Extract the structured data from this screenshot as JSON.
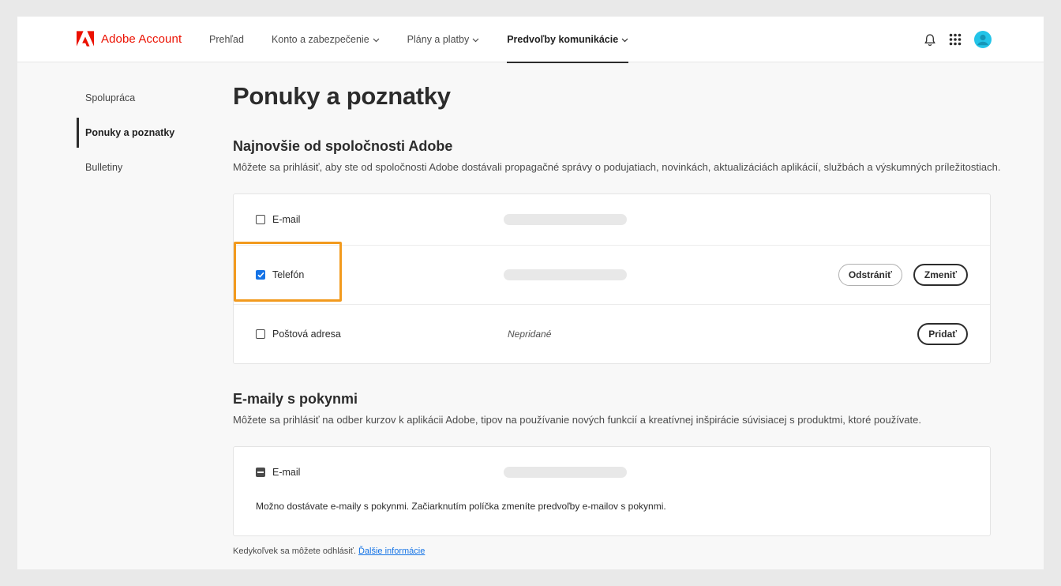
{
  "header": {
    "brand": "Adobe Account",
    "nav": [
      {
        "label": "Prehľad",
        "has_dropdown": false,
        "active": false
      },
      {
        "label": "Konto a zabezpečenie",
        "has_dropdown": true,
        "active": false
      },
      {
        "label": "Plány a platby",
        "has_dropdown": true,
        "active": false
      },
      {
        "label": "Predvoľby komunikácie",
        "has_dropdown": true,
        "active": true
      }
    ],
    "icons": [
      "bell-icon",
      "app-grid-icon",
      "avatar"
    ],
    "brand_color": "#eb1000",
    "avatar_color": "#23c4e8"
  },
  "sidebar": {
    "items": [
      {
        "label": "Spolupráca",
        "active": false
      },
      {
        "label": "Ponuky a poznatky",
        "active": true
      },
      {
        "label": "Bulletiny",
        "active": false
      }
    ]
  },
  "main": {
    "title": "Ponuky a poznatky",
    "section1": {
      "title": "Najnovšie od spoločnosti Adobe",
      "description": "Môžete sa prihlásiť, aby ste od spoločnosti Adobe dostávali propagačné správy o podujatiach, novinkách, aktualizáciách aplikácií, službách a výskumných príležitostiach.",
      "rows": [
        {
          "label": "E-mail",
          "checked": false
        },
        {
          "label": "Telefón",
          "checked": true,
          "remove_label": "Odstrániť",
          "change_label": "Zmeniť"
        },
        {
          "label": "Poštová adresa",
          "checked": false,
          "value": "Nepridané",
          "add_label": "Pridať"
        }
      ]
    },
    "section2": {
      "title": "E-maily s pokynmi",
      "description": "Môžete sa prihlásiť na odber kurzov k aplikácii Adobe, tipov na používanie nových funkcií a kreatívnej inšpirácie súvisiacej s produktmi, ktoré používate.",
      "row": {
        "label": "E-mail",
        "state": "mixed"
      },
      "note": "Možno dostávate e-maily s pokynmi. Začiarknutím políčka zmeníte predvoľby e-mailov s pokynmi."
    },
    "footer": {
      "text": "Kedykoľvek sa môžete odhlásiť. ",
      "link": "Ďalšie informácie"
    },
    "accent_color": "#1473e6",
    "highlight_color": "#f29a1e"
  }
}
